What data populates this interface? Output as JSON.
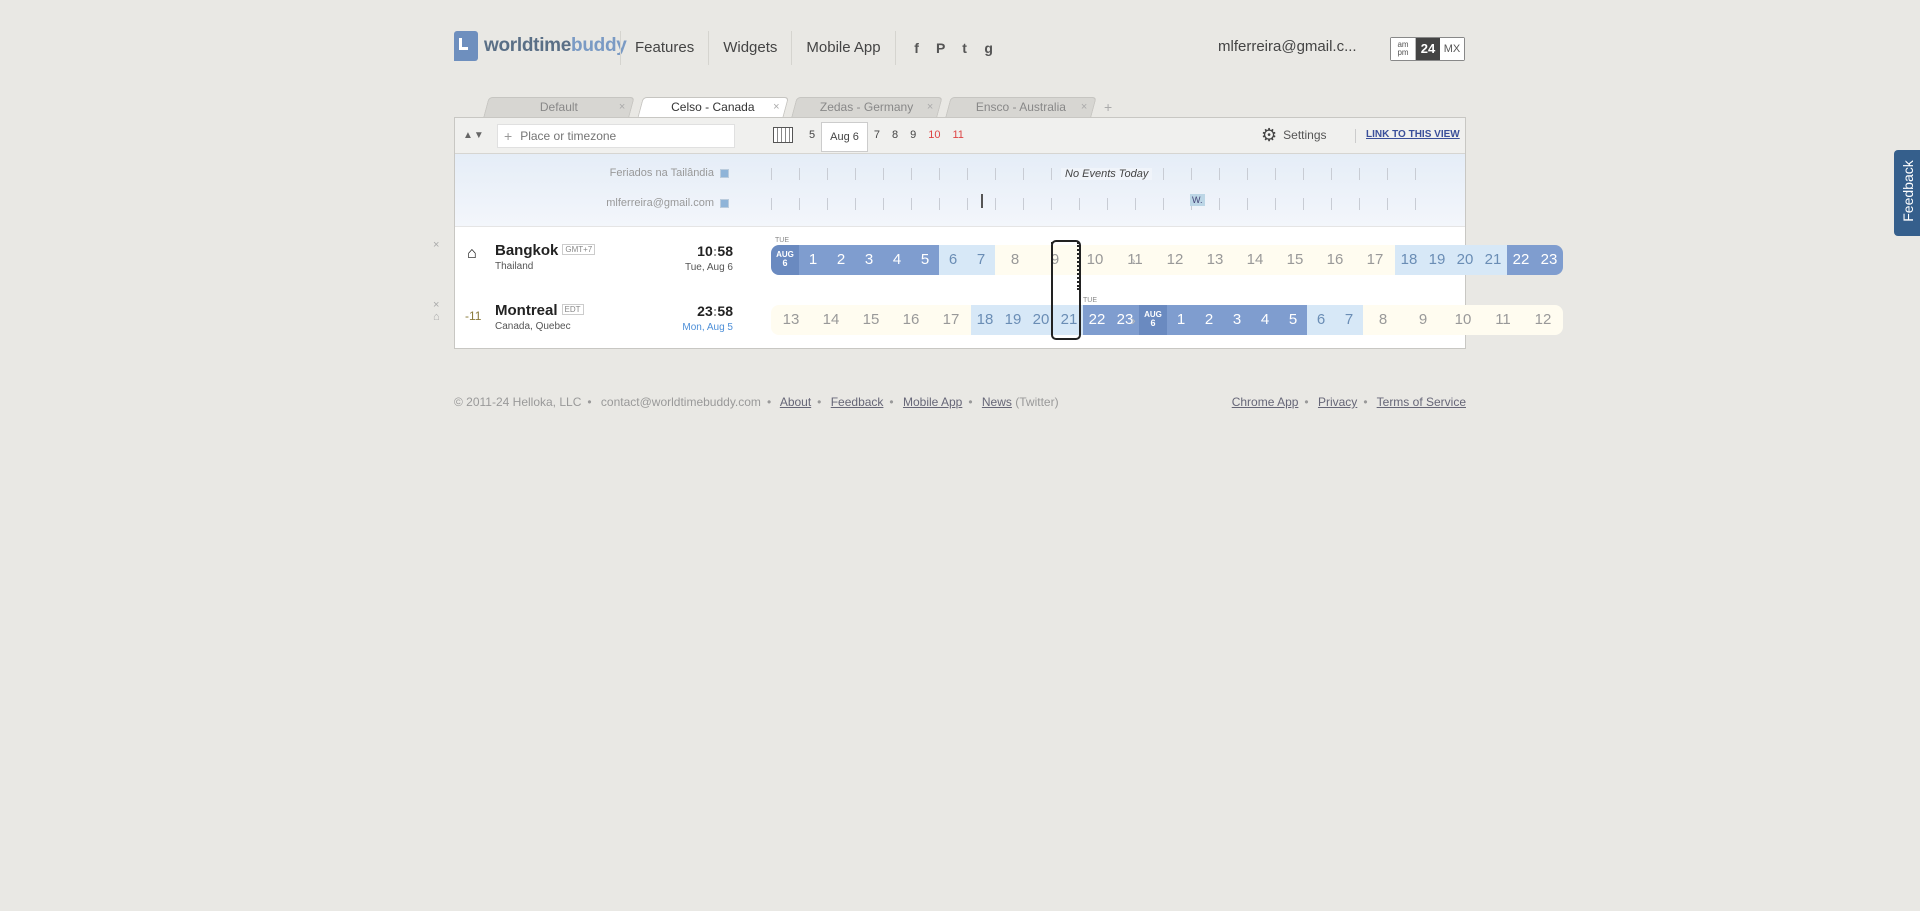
{
  "logo": {
    "part1": "worldtime",
    "part2": "buddy"
  },
  "nav": [
    "Features",
    "Widgets",
    "Mobile App"
  ],
  "social": [
    "f",
    "P",
    "t",
    "g"
  ],
  "user": "mlferreira@gmail.c...",
  "format": {
    "ampm": "am pm",
    "h24": "24",
    "mx": "MX"
  },
  "tabs": [
    {
      "label": "Default",
      "active": false
    },
    {
      "label": "Celso - Canada",
      "active": true
    },
    {
      "label": "Zedas - Germany",
      "active": false
    },
    {
      "label": "Ensco - Australia",
      "active": false
    }
  ],
  "tab_add": "+",
  "search": {
    "placeholder": "Place or timezone"
  },
  "dates": [
    "5",
    "Aug 6",
    "7",
    "8",
    "9",
    "10",
    "11"
  ],
  "settings_label": "Settings",
  "link_label": "LINK TO THIS VIEW",
  "events": {
    "cal1": "Feriados na Tailândia",
    "cal2": "mlferreira@gmail.com",
    "no_events": "No Events Today",
    "mark": "W."
  },
  "locations": [
    {
      "city": "Bangkok",
      "tz": "GMT+7",
      "country": "Thailand",
      "time_h": "10",
      "time_m": "58",
      "date": "Tue, Aug 6",
      "day_label": "TUE",
      "mark": "AUG 6",
      "hours": [
        "AUG 6",
        "1",
        "2",
        "3",
        "4",
        "5",
        "6",
        "7",
        "8",
        "9",
        "10",
        "11",
        "12",
        "13",
        "14",
        "15",
        "16",
        "17",
        "18",
        "19",
        "20",
        "21",
        "22",
        "23"
      ]
    },
    {
      "city": "Montreal",
      "tz": "EDT",
      "country": "Canada, Quebec",
      "offset": "-11",
      "time_h": "23",
      "time_m": "58",
      "date": "Mon, Aug 5",
      "day_label": "TUE",
      "hours": [
        "13",
        "14",
        "15",
        "16",
        "17",
        "18",
        "19",
        "20",
        "21",
        "22",
        "23",
        "AUG 6",
        "1",
        "2",
        "3",
        "4",
        "5",
        "6",
        "7",
        "8",
        "9",
        "10",
        "11",
        "12"
      ]
    }
  ],
  "footer": {
    "copyright": "© 2011-24 Helloka, LLC",
    "contact": "contact@worldtimebuddy.com",
    "about": "About",
    "feedback": "Feedback",
    "mobile": "Mobile App",
    "news": "News",
    "twitter": "(Twitter)",
    "chrome": "Chrome App",
    "privacy": "Privacy",
    "terms": "Terms of Service"
  },
  "feedback_tab": "Feedback"
}
